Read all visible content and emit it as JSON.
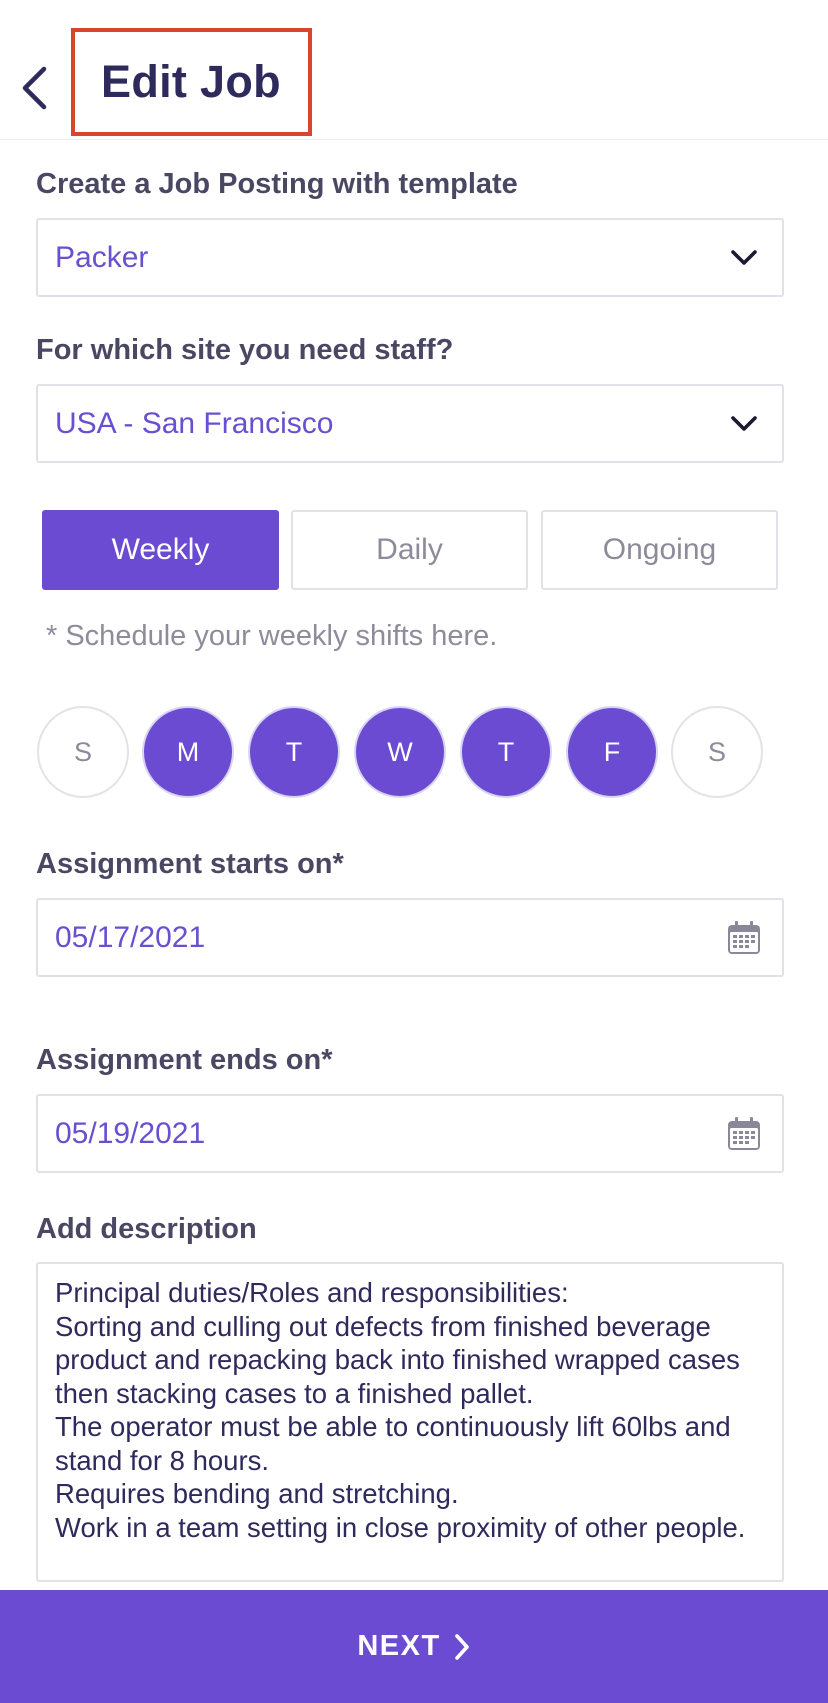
{
  "header": {
    "title": "Edit Job",
    "back_icon": "chevron-left-icon"
  },
  "template": {
    "label": "Create a Job Posting with template",
    "value": "Packer",
    "icon": "chevron-down-icon"
  },
  "site": {
    "label": "For which site you need staff?",
    "value": "USA - San Francisco",
    "icon": "chevron-down-icon"
  },
  "schedule": {
    "tabs": [
      {
        "label": "Weekly",
        "selected": true
      },
      {
        "label": "Daily",
        "selected": false
      },
      {
        "label": "Ongoing",
        "selected": false
      }
    ],
    "hint": "* Schedule your weekly shifts here.",
    "days": [
      {
        "label": "S",
        "selected": false
      },
      {
        "label": "M",
        "selected": true
      },
      {
        "label": "T",
        "selected": true
      },
      {
        "label": "W",
        "selected": true
      },
      {
        "label": "T",
        "selected": true
      },
      {
        "label": "F",
        "selected": true
      },
      {
        "label": "S",
        "selected": false
      }
    ]
  },
  "start": {
    "label": "Assignment starts on*",
    "value": "05/17/2021",
    "icon": "calendar-icon"
  },
  "end": {
    "label": "Assignment ends on*",
    "value": "05/19/2021",
    "icon": "calendar-icon"
  },
  "description": {
    "label": "Add description",
    "text": "Principal duties/Roles and responsibilities:\nSorting and culling out defects from finished beverage product and repacking back into finished wrapped cases then stacking cases to a finished pallet.\nThe operator must be able to continuously lift 60lbs and stand for 8 hours.\nRequires bending and stretching.\nWork in a team setting in close proximity of other people."
  },
  "footer": {
    "next_label": "NEXT",
    "next_icon": "chevron-right-icon"
  },
  "colors": {
    "accent": "#6a4bd1",
    "title": "#2e2a5c",
    "highlight": "#d6472d"
  }
}
